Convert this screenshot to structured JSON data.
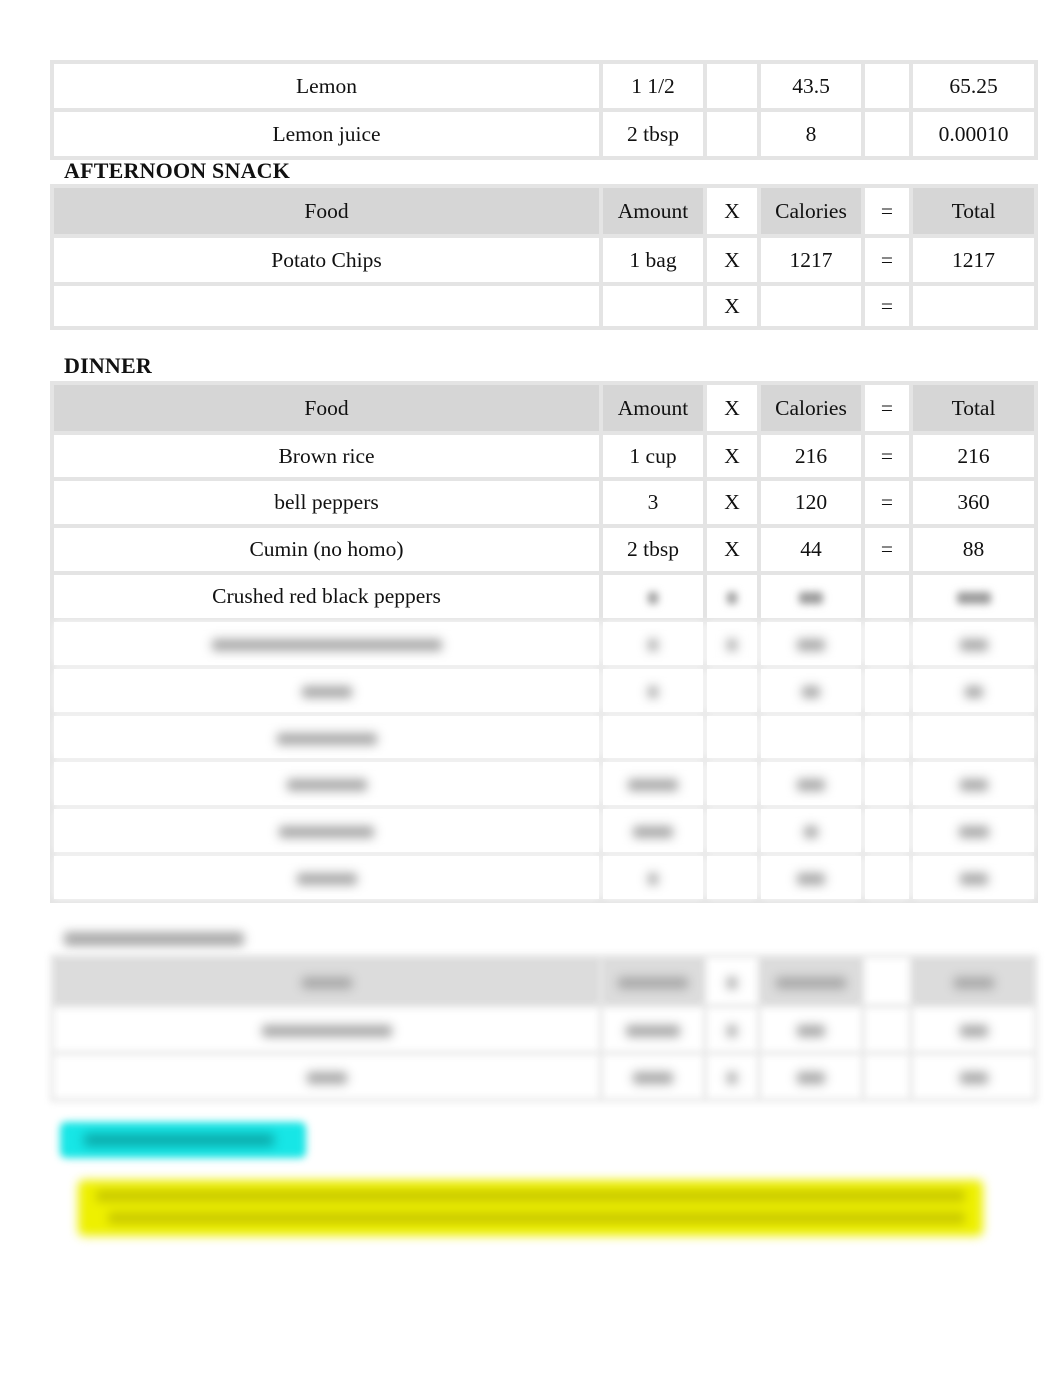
{
  "columns": {
    "food": "Food",
    "amount": "Amount",
    "times": "X",
    "calories": "Calories",
    "equals": "=",
    "total": "Total"
  },
  "lunch_tail": {
    "rows": [
      {
        "food": "Lemon",
        "amount": "1 1/2",
        "times": "",
        "calories": "43.5",
        "equals": "",
        "total": "65.25"
      },
      {
        "food": "Lemon juice",
        "amount": "2 tbsp",
        "times": "",
        "calories": "8",
        "equals": "",
        "total": "0.00010"
      }
    ]
  },
  "afternoon_snack": {
    "title": "AFTERNOON SNACK",
    "rows": [
      {
        "food": "Potato Chips",
        "amount": "1 bag",
        "times": "X",
        "calories": "1217",
        "equals": "=",
        "total": "1217"
      },
      {
        "food": "",
        "amount": "",
        "times": "X",
        "calories": "",
        "equals": "=",
        "total": ""
      }
    ]
  },
  "dinner": {
    "title": "DINNER",
    "rows": [
      {
        "food": "Brown rice",
        "amount": "1 cup",
        "times": "X",
        "calories": "216",
        "equals": "=",
        "total": "216"
      },
      {
        "food": "bell peppers",
        "amount": "3",
        "times": "X",
        "calories": "120",
        "equals": "=",
        "total": "360"
      },
      {
        "food": "Cumin (no homo)",
        "amount": "2 tbsp",
        "times": "X",
        "calories": "44",
        "equals": "=",
        "total": "88"
      },
      {
        "food": "Crushed red black peppers",
        "amount": "",
        "times": "",
        "calories": "",
        "equals": "",
        "total": ""
      }
    ],
    "blurred_row_count": 6
  },
  "evening_snack": {
    "blurred_row_count": 2
  },
  "notes": {
    "cyan_highlight_color": "#17e6e6",
    "yellow_highlight_color": "#eef000"
  }
}
